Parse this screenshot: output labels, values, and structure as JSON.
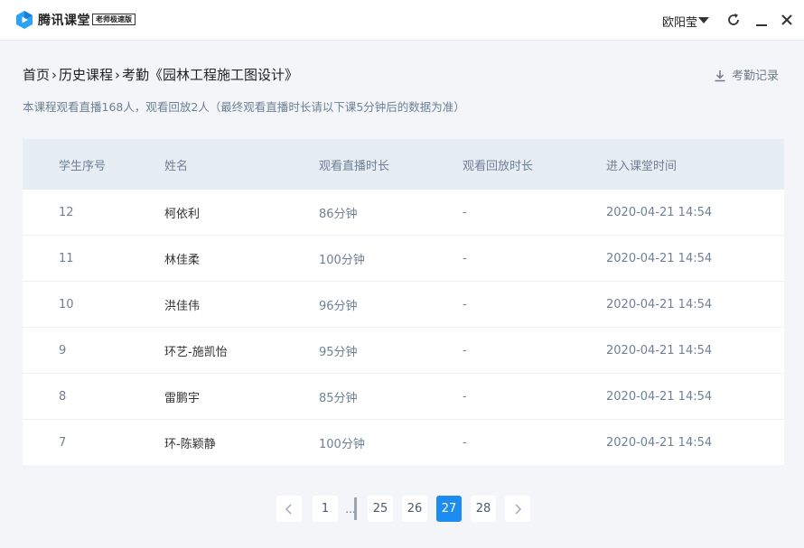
{
  "app": {
    "title": "腾讯课堂",
    "edition": "老师极速版",
    "user": "欧阳莹"
  },
  "breadcrumb": {
    "home": "首页",
    "history": "历史课程",
    "current": "考勤《园林工程施工图设计》",
    "separator": "›"
  },
  "records_link": "考勤记录",
  "summary": "本课程观看直播168人，观看回放2人（最终观看直播时长请以下课5分钟后的数据为准）",
  "table": {
    "headers": [
      "学生序号",
      "姓名",
      "观看直播时长",
      "观看回放时长",
      "进入课堂时间"
    ],
    "rows": [
      {
        "id": "12",
        "name": "柯依利",
        "live": "86分钟",
        "replay": "-",
        "time": "2020-04-21 14:54"
      },
      {
        "id": "11",
        "name": "林佳柔",
        "live": "100分钟",
        "replay": "-",
        "time": "2020-04-21 14:54"
      },
      {
        "id": "10",
        "name": "洪佳伟",
        "live": "96分钟",
        "replay": "-",
        "time": "2020-04-21 14:54"
      },
      {
        "id": "9",
        "name": "环艺-施凯怡",
        "live": "95分钟",
        "replay": "-",
        "time": "2020-04-21 14:54"
      },
      {
        "id": "8",
        "name": "雷鹏宇",
        "live": "85分钟",
        "replay": "-",
        "time": "2020-04-21 14:54"
      },
      {
        "id": "7",
        "name": "环-陈颖静",
        "live": "100分钟",
        "replay": "-",
        "time": "2020-04-21 14:54"
      }
    ]
  },
  "pagination": {
    "first": "1",
    "ellipsis": "...",
    "pages": [
      "25",
      "26",
      "27",
      "28"
    ],
    "current": "27"
  },
  "colors": {
    "accent": "#1c8cf0",
    "header_bg": "#e7edf4",
    "muted_text": "#6e8094"
  }
}
